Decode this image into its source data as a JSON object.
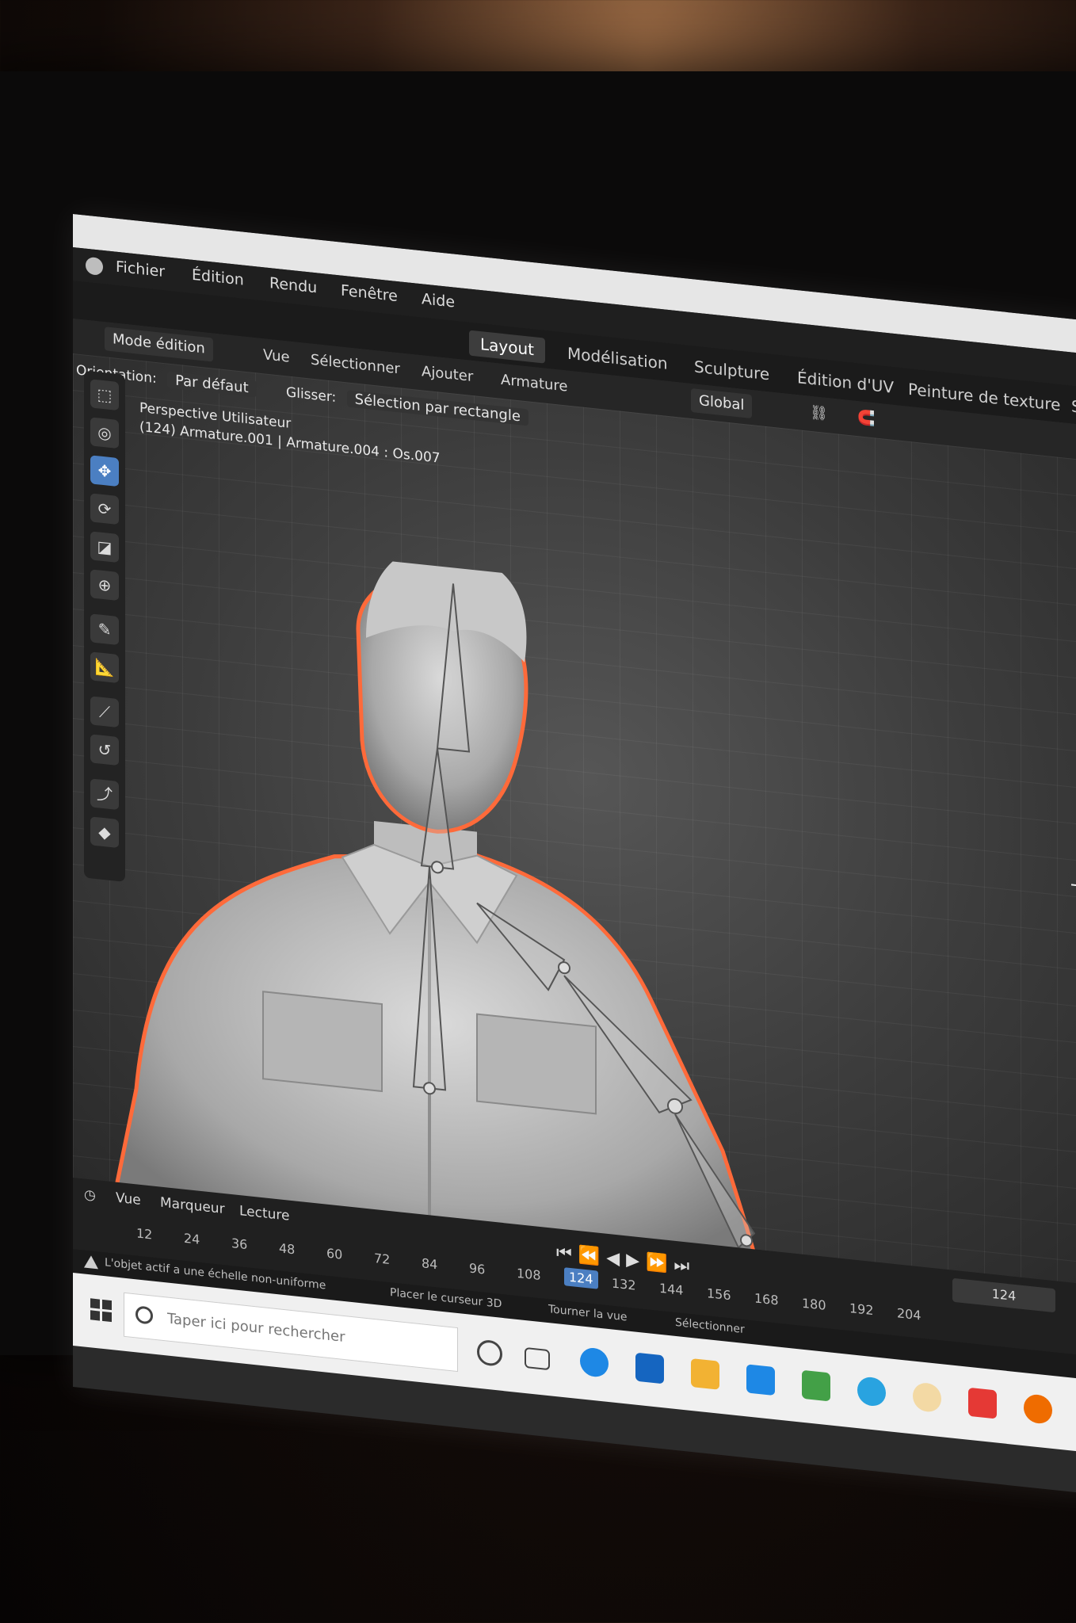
{
  "menubar": {
    "items": [
      "Fichier",
      "Édition",
      "Rendu",
      "Fenêtre",
      "Aide"
    ]
  },
  "workspaces": {
    "tabs": [
      "Layout",
      "Modélisation",
      "Sculpture",
      "Édition d'UV",
      "Peinture de texture",
      "Shading"
    ],
    "active": "Layout"
  },
  "header": {
    "mode": "Mode édition",
    "menus": [
      "Vue",
      "Sélectionner",
      "Ajouter",
      "Armature"
    ],
    "orientation_label": "Orientation:",
    "orientation_value": "Par défaut",
    "drag_label": "Glisser:",
    "drag_value": "Sélection par rectangle",
    "transform_space": "Global"
  },
  "viewport": {
    "view_name": "Perspective Utilisateur",
    "object_info": "(124) Armature.001 | Armature.004 : Os.007"
  },
  "toolbar": {
    "tools": [
      "select-box",
      "cursor",
      "move",
      "rotate",
      "scale",
      "transform",
      "annotate",
      "measure",
      "bone-size",
      "roll",
      "extrude",
      "envelope"
    ],
    "active_index": 2
  },
  "timeline": {
    "menus": [
      "Vue",
      "Marqueur",
      "Lecture"
    ],
    "frames": [
      "12",
      "24",
      "36",
      "48",
      "60",
      "72",
      "84",
      "96",
      "108",
      "124",
      "132",
      "144",
      "156",
      "168",
      "180",
      "192",
      "204"
    ],
    "current_frame": "124",
    "frame_field": "124"
  },
  "statusbar": {
    "warning": "L'objet actif a une échelle non-uniforme",
    "hint1": "Placer le curseur 3D",
    "hint2": "Tourner la vue",
    "hint3": "Sélectionner"
  },
  "taskbar": {
    "search_placeholder": "Taper ici pour rechercher",
    "colors": {
      "edge": "#1e88e5",
      "store": "#1565c0",
      "files": "#f2b233",
      "mail": "#1e88e5",
      "photos": "#43a047",
      "telegram": "#29a3e0",
      "paint": "#e53935",
      "blender": "#ef6c00"
    }
  },
  "colors": {
    "accent": "#4b7fc2",
    "selection_outline": "#ff6a3a"
  }
}
